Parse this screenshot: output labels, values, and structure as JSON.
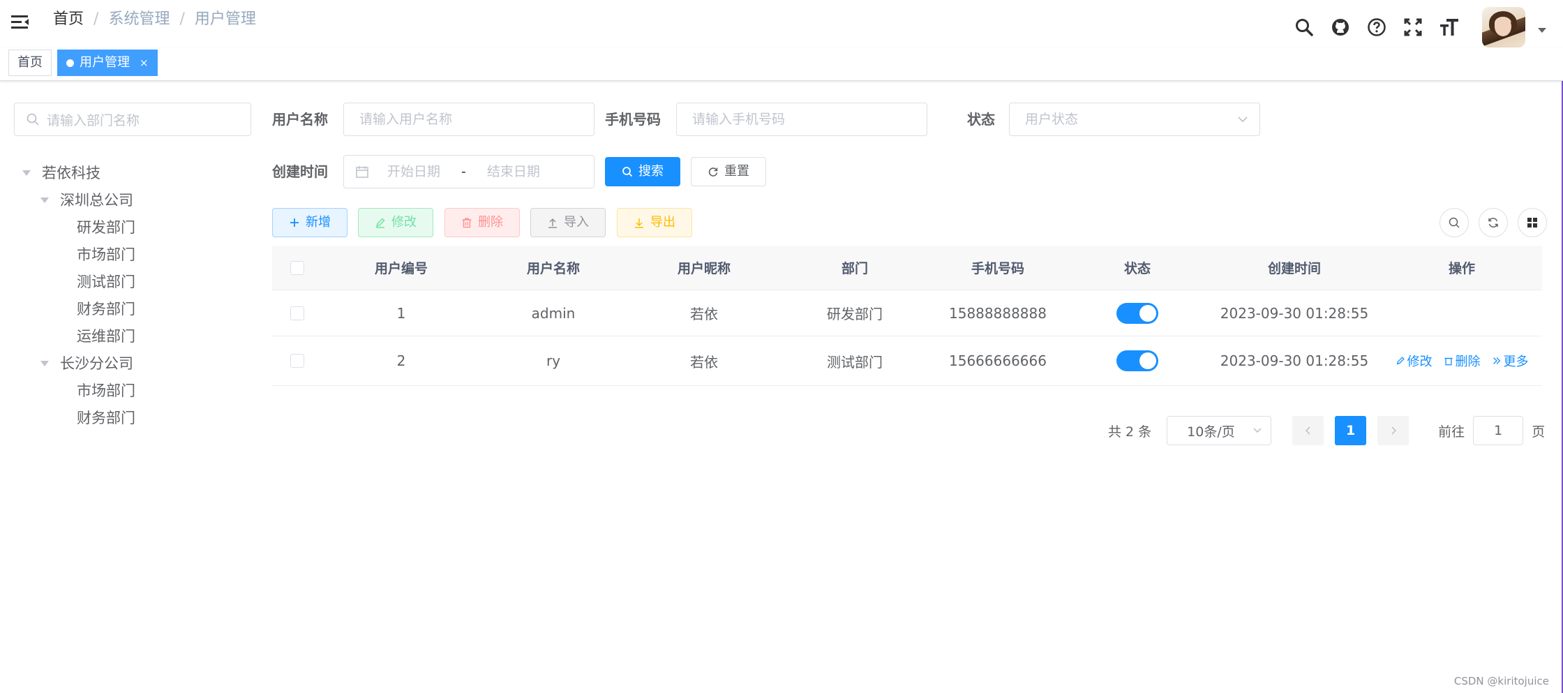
{
  "breadcrumb": {
    "items": [
      "首页",
      "系统管理",
      "用户管理"
    ],
    "separator": "/"
  },
  "header_icons": [
    "search-icon",
    "github-icon",
    "question-icon",
    "fullscreen-icon",
    "font-size-icon"
  ],
  "tags": {
    "home": "首页",
    "active": "用户管理",
    "close": "×"
  },
  "dept_search": {
    "placeholder": "请输入部门名称"
  },
  "dept_tree": [
    {
      "label": "若依科技",
      "level": 0,
      "expanded": true
    },
    {
      "label": "深圳总公司",
      "level": 1,
      "expanded": true
    },
    {
      "label": "研发部门",
      "level": 2
    },
    {
      "label": "市场部门",
      "level": 2
    },
    {
      "label": "测试部门",
      "level": 2
    },
    {
      "label": "财务部门",
      "level": 2
    },
    {
      "label": "运维部门",
      "level": 2
    },
    {
      "label": "长沙分公司",
      "level": 1,
      "expanded": true
    },
    {
      "label": "市场部门",
      "level": 2
    },
    {
      "label": "财务部门",
      "level": 2
    }
  ],
  "query": {
    "username_label": "用户名称",
    "username_placeholder": "请输入用户名称",
    "phone_label": "手机号码",
    "phone_placeholder": "请输入手机号码",
    "status_label": "状态",
    "status_placeholder": "用户状态",
    "date_label": "创建时间",
    "start_placeholder": "开始日期",
    "range_sep": "-",
    "end_placeholder": "结束日期",
    "search_btn": "搜索",
    "reset_btn": "重置"
  },
  "toolbar": {
    "add": "新增",
    "edit": "修改",
    "delete": "删除",
    "import": "导入",
    "export": "导出"
  },
  "table": {
    "headers": [
      "用户编号",
      "用户名称",
      "用户昵称",
      "部门",
      "手机号码",
      "状态",
      "创建时间",
      "操作"
    ],
    "rows": [
      {
        "id": "1",
        "username": "admin",
        "nickname": "若依",
        "dept": "研发部门",
        "phone": "15888888888",
        "status_on": true,
        "created": "2023-09-30 01:28:55",
        "ops": []
      },
      {
        "id": "2",
        "username": "ry",
        "nickname": "若依",
        "dept": "测试部门",
        "phone": "15666666666",
        "status_on": true,
        "created": "2023-09-30 01:28:55",
        "ops": [
          "修改",
          "删除",
          "更多"
        ]
      }
    ]
  },
  "pagination": {
    "total": "共 2 条",
    "page_size": "10条/页",
    "current": "1",
    "goto_label": "前往",
    "goto_value": "1",
    "page_unit": "页"
  },
  "watermark": "CSDN @kiritojuice",
  "colors": {
    "primary": "#1890ff",
    "success": "#13ce66",
    "danger": "#ff4949",
    "warning": "#ffba00"
  }
}
